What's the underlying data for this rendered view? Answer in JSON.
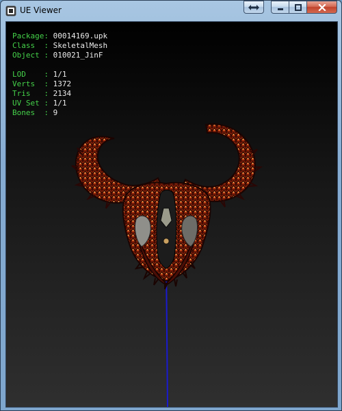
{
  "window": {
    "title": "UE Viewer"
  },
  "caption_buttons": {
    "swap": "swap-icon",
    "minimize": "minimize-icon",
    "maximize": "maximize-icon",
    "close": "close-icon"
  },
  "info": {
    "package": {
      "label": "Package",
      "value": "00014169.upk"
    },
    "class": {
      "label": "Class  ",
      "value": "SkeletalMesh"
    },
    "object": {
      "label": "Object ",
      "value": "010021_JinF"
    },
    "lod": {
      "label": "LOD    ",
      "value": "1/1"
    },
    "verts": {
      "label": "Verts  ",
      "value": "1372"
    },
    "tris": {
      "label": "Tris   ",
      "value": "2134"
    },
    "uvset": {
      "label": "UV Set ",
      "value": "1/1"
    },
    "bones": {
      "label": "Bones  ",
      "value": "9"
    }
  },
  "colors": {
    "label": "#45d24a",
    "value": "#ececec",
    "axis": "#1a1ad0",
    "mesh_dark": "#2a0804",
    "mesh_red": "#a0240a",
    "mesh_orange": "#e0701e"
  }
}
